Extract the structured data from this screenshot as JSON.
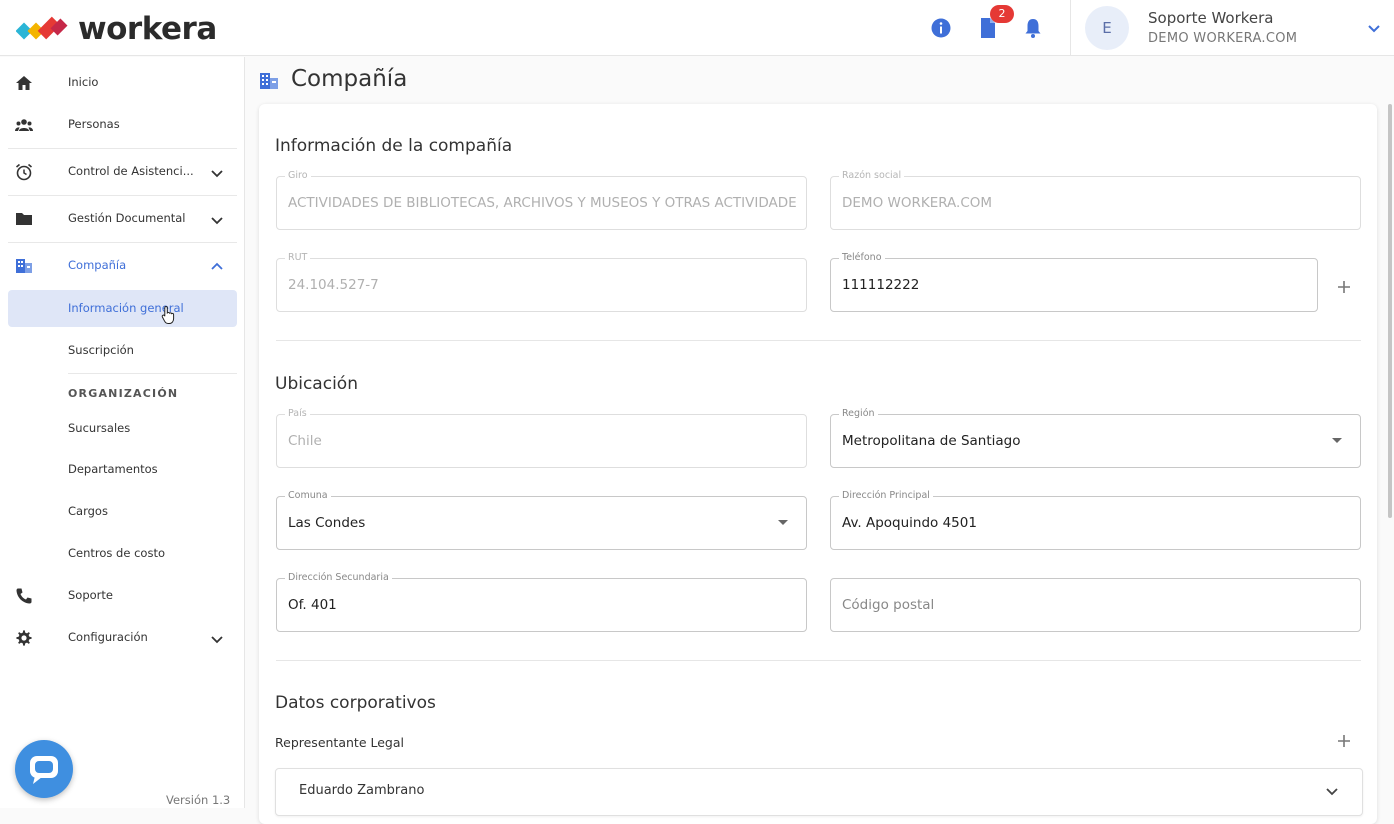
{
  "header": {
    "logo_text": "workera",
    "notifications_badge": "2",
    "user": {
      "avatar_initial": "E",
      "name": "Soporte Workera",
      "org": "DEMO WORKERA.COM"
    }
  },
  "sidebar": {
    "items": [
      {
        "label": "Inicio",
        "icon": "home-icon"
      },
      {
        "label": "Personas",
        "icon": "people-icon"
      },
      {
        "label": "Control de Asistenci...",
        "icon": "alarm-clock-icon"
      },
      {
        "label": "Gestión Documental",
        "icon": "folder-icon"
      },
      {
        "label": "Compañía",
        "icon": "building-icon"
      },
      {
        "label": "Soporte",
        "icon": "phone-icon"
      },
      {
        "label": "Configuración",
        "icon": "gear-icon"
      }
    ],
    "company_sub": [
      "Información general",
      "Suscripción"
    ],
    "org_header": "ORGANIZACIÓN",
    "org_items": [
      "Sucursales",
      "Departamentos",
      "Cargos",
      "Centros de costo"
    ],
    "version": "Versión 1.3"
  },
  "page": {
    "title": "Compañía",
    "company_info": {
      "title": "Información de la compañía",
      "giro_label": "Giro",
      "giro_value": "ACTIVIDADES DE BIBLIOTECAS, ARCHIVOS Y MUSEOS Y OTRAS ACTIVIDADES CUL",
      "razon_label": "Razón social",
      "razon_value": "DEMO WORKERA.COM",
      "rut_label": "RUT",
      "rut_value": "24.104.527-7",
      "telefono_label": "Teléfono",
      "telefono_value": "111112222"
    },
    "location": {
      "title": "Ubicación",
      "pais_label": "País",
      "pais_value": "Chile",
      "region_label": "Región",
      "region_value": "Metropolitana de Santiago",
      "comuna_label": "Comuna",
      "comuna_value": "Las Condes",
      "dir_principal_label": "Dirección Principal",
      "dir_principal_value": "Av. Apoquindo 4501",
      "dir_secundaria_label": "Dirección Secundaria",
      "dir_secundaria_value": "Of. 401",
      "codigo_postal_placeholder": "Código postal"
    },
    "corporate": {
      "title": "Datos corporativos",
      "rep_label": "Representante Legal",
      "rep_name": "Eduardo Zambrano"
    }
  },
  "colors": {
    "accent": "#3f6fd8",
    "active_bg": "#dfe6f7",
    "badge": "#e53935",
    "chat": "#3f8fe0"
  }
}
